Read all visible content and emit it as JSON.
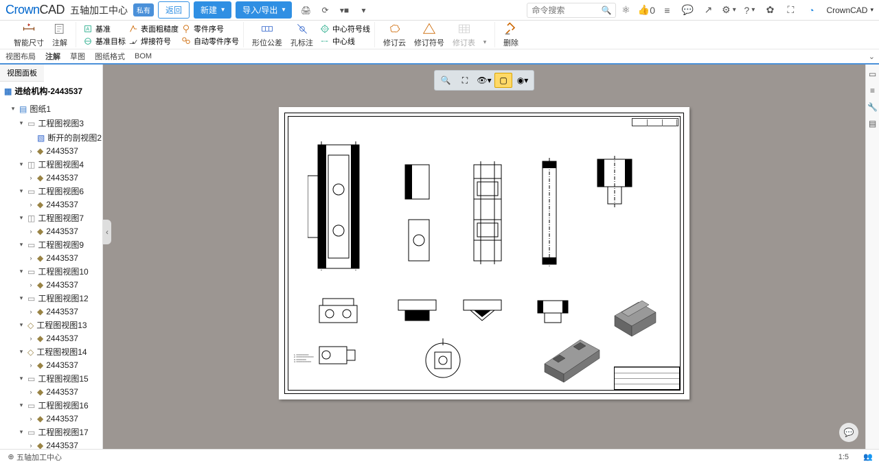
{
  "app": {
    "brand_c": "Crown",
    "brand_cad": "CAD",
    "doc_title": "五轴加工中心",
    "private_badge": "私有"
  },
  "top_buttons": {
    "back": "返回",
    "new": "新建",
    "import_export": "导入/导出"
  },
  "search": {
    "placeholder": "命令搜索"
  },
  "msg_count": "0",
  "account": "CrownCAD",
  "ribbon": {
    "smart_dim": "智能尺寸",
    "annotate": "注解",
    "datum": "基准",
    "datum_target": "基准目标",
    "surface_rough": "表面粗糙度",
    "weld_symbol": "焊接符号",
    "part_no": "零件序号",
    "auto_part_no": "自动零件序号",
    "shape_tol": "形位公差",
    "hole_callout": "孔标注",
    "center_symbol": "中心符号线",
    "center_line": "中心线",
    "rev_cloud": "修订云",
    "rev_symbol": "修订符号",
    "rev_table": "修订表",
    "delete": "删除"
  },
  "tabs": {
    "layout": "视图布局",
    "annotate": "注解",
    "sketch": "草图",
    "sheet_format": "图纸格式",
    "bom": "BOM"
  },
  "sidebar": {
    "panel_tab": "视图面板",
    "doc": "进给机构-2443537",
    "sheet": "图纸1",
    "child_id": "2443537",
    "views": {
      "v3": "工程图视图3",
      "broken": "断开的剖视图2",
      "v4": "工程图视图4",
      "v6": "工程图视图6",
      "v7": "工程图视图7",
      "v9": "工程图视图9",
      "v10": "工程图视图10",
      "v12": "工程图视图12",
      "v13": "工程图视图13",
      "v14": "工程图视图14",
      "v15": "工程图视图15",
      "v16": "工程图视图16",
      "v17": "工程图视图17"
    }
  },
  "status": {
    "doc": "五轴加工中心",
    "scale": "1:5"
  }
}
